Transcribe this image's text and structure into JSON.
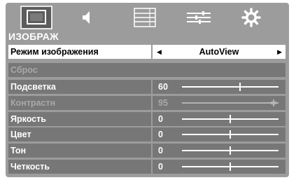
{
  "tabs": [
    {
      "name": "picture",
      "icon": "picture-icon",
      "active": true
    },
    {
      "name": "sound",
      "icon": "speaker-icon",
      "active": false
    },
    {
      "name": "channels",
      "icon": "list-icon",
      "active": false
    },
    {
      "name": "functions",
      "icon": "sliders-icon",
      "active": false
    },
    {
      "name": "settings",
      "icon": "gear-icon",
      "active": false
    }
  ],
  "section_title": "ИЗОБРАЖ",
  "picture_mode": {
    "label": "Режим изображения",
    "value": "AutoView",
    "prev_arrow": "◀",
    "next_arrow": "▶"
  },
  "reset": {
    "label": "Сброс",
    "enabled": false
  },
  "settings": [
    {
      "label": "Подсветка",
      "value": "60",
      "level": 0.6,
      "enabled": true
    },
    {
      "label": "Контрастн",
      "value": "95",
      "level": 0.95,
      "enabled": false
    },
    {
      "label": "Яркость",
      "value": "0",
      "level": 0.5,
      "enabled": true
    },
    {
      "label": "Цвет",
      "value": "0",
      "level": 0.5,
      "enabled": true
    },
    {
      "label": "Тон",
      "value": "0",
      "level": 0.5,
      "enabled": true
    },
    {
      "label": "Четкость",
      "value": "0",
      "level": 0.5,
      "enabled": true
    }
  ],
  "scroll_indicator": "▼",
  "colors": {
    "panel": "#9c9c9c",
    "row": "#777777",
    "selected": "#ffffff",
    "disabled_text": "#a8a8a8"
  }
}
